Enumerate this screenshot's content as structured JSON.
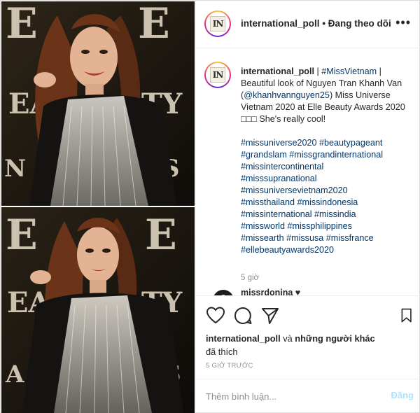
{
  "header": {
    "username": "international_poll",
    "separator": " • ",
    "follow_status": "Đang theo dõi",
    "avatar_mark": "IN",
    "more_icon": "more-horizontal-icon"
  },
  "caption": {
    "username": "international_poll",
    "text_1": " | ",
    "hashtag_1": "#MissVietnam",
    "text_2": " | Beautiful look of Nguyen Tran Khanh Van (",
    "mention": "@khanhvannguyen25",
    "text_3": ") Miss Universe Vietnam 2020 at Elle Beauty Awards 2020 ",
    "emoji": "□□□",
    "text_4": " She's really cool!",
    "hashtags": [
      "#missuniverse2020 #beautypageant",
      "#grandslam #missgrandinternational",
      "#missintercontinental",
      "#misssupranational",
      "#missuniversevietnam2020",
      "#missthailand #missindonesia",
      "#missinternational #missindia",
      "#missworld #missphilippines",
      "#missearth #missusa #missfrance",
      "#ellebeautyawards2020"
    ],
    "time_ago": "5 giờ"
  },
  "first_comment": {
    "username": "missrdonina ♥"
  },
  "actions": {
    "like_icon": "heart-icon",
    "comment_icon": "comment-bubble-icon",
    "share_icon": "paper-plane-icon",
    "save_icon": "bookmark-icon"
  },
  "likes": {
    "user": "international_poll",
    "and_text": " và ",
    "others": "những người khác",
    "liked_text": "đã thích"
  },
  "posted_time": "5 GIỜ TRƯỚC",
  "comment_box": {
    "placeholder": "Thêm bình luận...",
    "post_label": "Đăng"
  },
  "colors": {
    "link": "#00376b",
    "muted": "#8e8e8e",
    "post_button": "#b2dffc",
    "border": "#dbdbdb"
  }
}
